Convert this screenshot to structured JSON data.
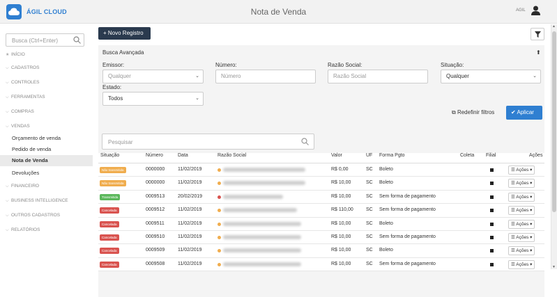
{
  "app": {
    "brand": "ÁGIL CLOUD",
    "title": "Nota de Venda",
    "user_label": "AGIL"
  },
  "sidebar": {
    "search_placeholder": "Busca (Ctrl+Enter)",
    "items": [
      "INÍCIO",
      "CADASTROS",
      "CONTROLES",
      "FERRAMENTAS",
      "COMPRAS",
      "VENDAS"
    ],
    "vendas_sub": [
      "Orçamento de venda",
      "Pedido de venda",
      "Nota de Venda",
      "Devoluções"
    ],
    "items_after": [
      "FINANCEIRO",
      "BUSINESS INTELLIGENCE",
      "OUTROS CADASTROS",
      "RELATÓRIOS"
    ]
  },
  "toolbar": {
    "new_label": "+ Novo Registro"
  },
  "advanced_search": {
    "title": "Busca Avançada",
    "emissor_label": "Emissor:",
    "emissor_value": "Qualquer",
    "numero_label": "Número:",
    "numero_placeholder": "Número",
    "razao_label": "Razão Social:",
    "razao_placeholder": "Razão Social",
    "situacao_label": "Situação:",
    "situacao_value": "Qualquer",
    "estado_label": "Estado:",
    "estado_value": "Todos",
    "reset_label": "Redefinir filtros",
    "apply_label": "Aplicar"
  },
  "table": {
    "search_placeholder": "Pesquisar",
    "headers": [
      "Situação",
      "Número",
      "Data",
      "Razão Social",
      "Valor",
      "UF",
      "Forma Pgto",
      "Coleta",
      "Filial",
      "Ações"
    ],
    "actions_label": "Ações",
    "rows": [
      {
        "status": "Não transmitida",
        "numero": "0000000",
        "data": "11/02/2019",
        "valor": "R$ 0,00",
        "uf": "SC",
        "forma": "Boleto"
      },
      {
        "status": "Não transmitida",
        "numero": "0000000",
        "data": "11/02/2019",
        "valor": "R$ 10,00",
        "uf": "SC",
        "forma": "Boleto"
      },
      {
        "status": "Transmitida",
        "numero": "0009513",
        "data": "20/02/2019",
        "valor": "R$ 10,00",
        "uf": "SC",
        "forma": "Sem forma de pagamento"
      },
      {
        "status": "Cancelada",
        "numero": "0009512",
        "data": "11/02/2019",
        "valor": "R$ 110,00",
        "uf": "SC",
        "forma": "Sem forma de pagamento"
      },
      {
        "status": "Cancelada",
        "numero": "0009511",
        "data": "11/02/2019",
        "valor": "R$ 10,00",
        "uf": "SC",
        "forma": "Boleto"
      },
      {
        "status": "Cancelada",
        "numero": "0009510",
        "data": "11/02/2019",
        "valor": "R$ 10,00",
        "uf": "SC",
        "forma": "Sem forma de pagamento"
      },
      {
        "status": "Cancelada",
        "numero": "0009509",
        "data": "11/02/2019",
        "valor": "R$ 10,00",
        "uf": "SC",
        "forma": "Boleto"
      },
      {
        "status": "Cancelada",
        "numero": "0009508",
        "data": "11/02/2019",
        "valor": "R$ 10,00",
        "uf": "SC",
        "forma": "Sem forma de pagamento"
      }
    ]
  },
  "colors": {
    "nao_transmitida": "#f0ad4e",
    "transmitida": "#5cb85c",
    "cancelada": "#d9534f",
    "dot_orange": "#f0ad4e",
    "dot_red": "#d9534f",
    "brand_blue": "#2f7fd1",
    "dark_button": "#2a3a4e"
  },
  "row_dots": [
    "orange",
    "orange",
    "red",
    "orange",
    "orange",
    "orange",
    "orange",
    "orange"
  ]
}
